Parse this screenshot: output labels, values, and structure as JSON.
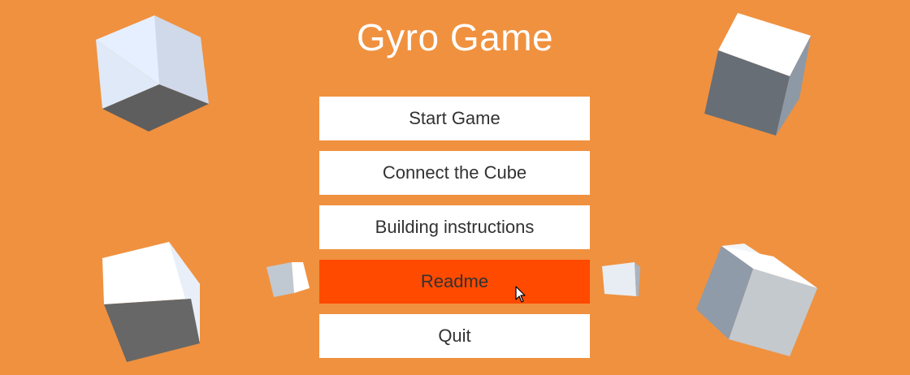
{
  "game": {
    "title": "Gyro Game"
  },
  "colors": {
    "background": "#F0913F",
    "button": "#FFFFFF",
    "button_highlight": "#FF4A00",
    "button_text": "#323232",
    "title_text": "#FFFFFF"
  },
  "menu": {
    "items": [
      {
        "id": "start-game",
        "label": "Start Game",
        "highlighted": false
      },
      {
        "id": "connect-the-cube",
        "label": "Connect the Cube",
        "highlighted": false
      },
      {
        "id": "building-instructions",
        "label": "Building instructions",
        "highlighted": false
      },
      {
        "id": "readme",
        "label": "Readme",
        "highlighted": true
      },
      {
        "id": "quit",
        "label": "Quit",
        "highlighted": false
      }
    ]
  },
  "decorations": {
    "cube_icon": "cube-icon",
    "cursor_icon": "mouse-pointer-icon"
  }
}
